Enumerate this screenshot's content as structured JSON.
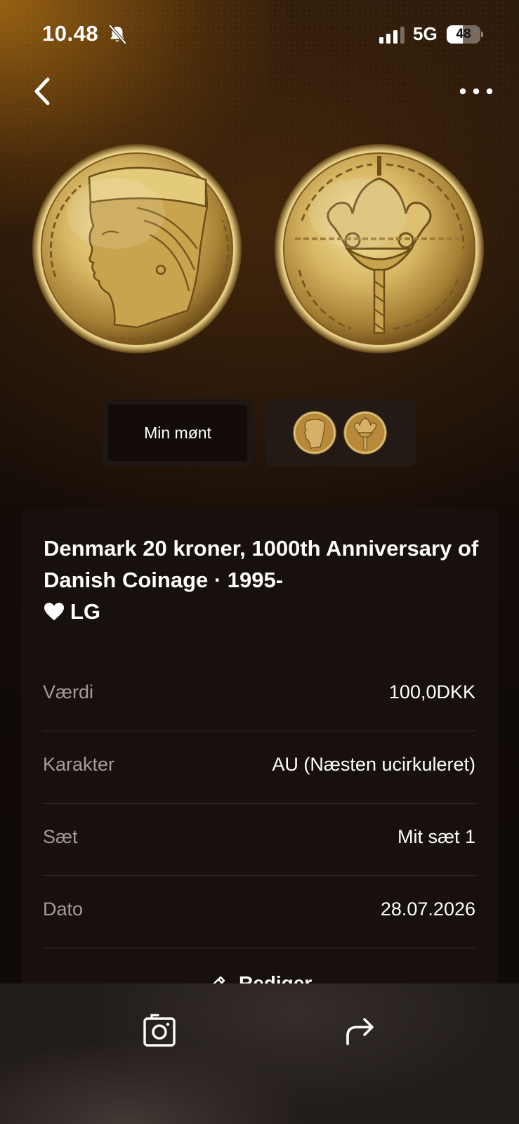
{
  "status_bar": {
    "time": "10.48",
    "network": "5G",
    "battery_percent": "48",
    "battery_level": 0.48,
    "signal_bars": 4,
    "icons": [
      "bell-off-icon",
      "signal-icon",
      "battery-icon"
    ]
  },
  "nav": {
    "back_icon": "chevron-left-icon",
    "more_icon": "ellipsis-icon"
  },
  "images": {
    "obverse": "coin-obverse-queen-margrethe",
    "reverse": "coin-reverse-crown-dansk-mont",
    "my_coin_label": "Min mønt",
    "reference_thumbnails": [
      "coin-obverse-thumb",
      "coin-reverse-thumb"
    ]
  },
  "details": {
    "title": "Denmark 20 kroner, 1000th Anniversary of Danish Coinage · 1995-",
    "title_suffix": "LG",
    "favorite_icon": "heart-icon",
    "rows": [
      {
        "label": "Værdi",
        "value": "100,0DKK"
      },
      {
        "label": "Karakter",
        "value": "AU (Næsten ucirkuleret)"
      },
      {
        "label": "Sæt",
        "value": "Mit sæt 1"
      },
      {
        "label": "Dato",
        "value": "28.07.2026"
      }
    ],
    "edit_label": "Rediger",
    "edit_icon": "pencil-icon"
  },
  "bottom_bar": {
    "camera_icon": "camera-icon",
    "share_icon": "share-icon"
  },
  "colors": {
    "accent_gold": "#c9a54a",
    "card_bg": "#17100d",
    "label_gray": "#a49c98"
  }
}
